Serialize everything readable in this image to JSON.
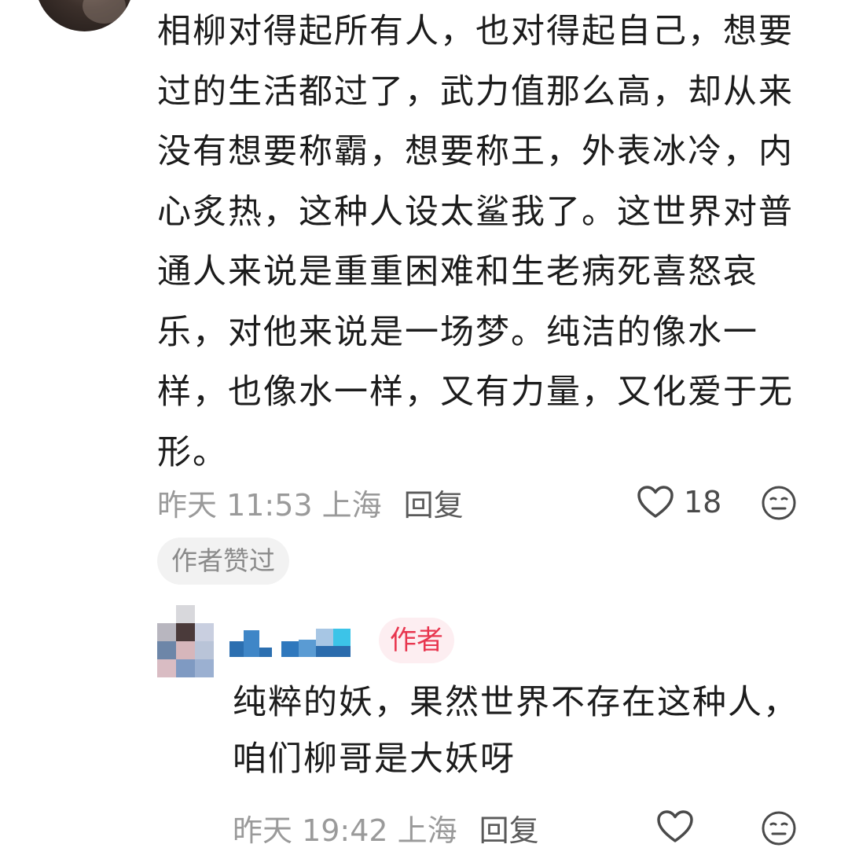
{
  "comment": {
    "text": "相柳对得起所有人，也对得起自己，想要过的生活都过了，武力值那么高，却从来没有想要称霸，想要称王，外表冰冷，内心炙热，这种人设太鲨我了。这世界对普通人来说是重重困难和生老病死喜怒哀乐，对他来说是一场梦。纯洁的像水一样，也像水一样，又有力量，又化爱于无形。",
    "time": "昨天 11:53 上海",
    "reply_label": "回复",
    "like_count": "18",
    "liked_badge": "作者赞过"
  },
  "reply": {
    "author_badge": "作者",
    "text": "纯粹的妖，果然世界不存在这种人，咱们柳哥是大妖呀",
    "time": "昨天 19:42 上海",
    "reply_label": "回复"
  },
  "icons": {
    "like": "heart-outline-icon",
    "emoji": "emoji-neutral-face-icon"
  },
  "colors": {
    "author_badge_text": "#e8364f",
    "author_badge_bg": "#fdeef1",
    "meta_text": "#9a9a9a"
  }
}
